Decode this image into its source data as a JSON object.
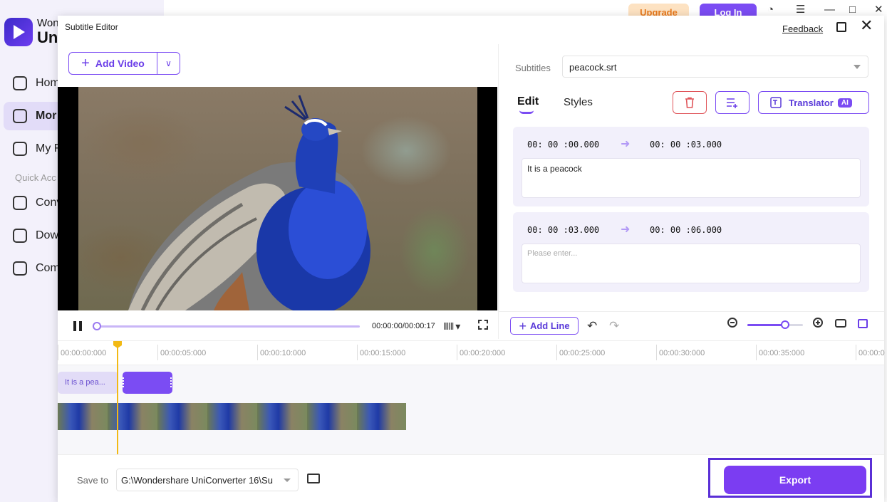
{
  "background_app": {
    "brand_line1": "Won",
    "brand_line2": "Un",
    "nav": [
      "Hom",
      "Mor",
      "My F",
      "Conv",
      "Dow",
      "Com"
    ],
    "quick_access": "Quick Acc",
    "upgrade": "Upgrade",
    "login": "Log In"
  },
  "dialog": {
    "title": "Subtitle Editor",
    "feedback": "Feedback"
  },
  "left": {
    "add_video": "Add Video",
    "timecode": "00:00:00/00:00:17"
  },
  "right": {
    "subtitles_label": "Subtitles",
    "subtitles_file": "peacock.srt",
    "tabs": {
      "edit": "Edit",
      "styles": "Styles"
    },
    "translator": "Translator",
    "ai_badge": "AI",
    "entries": [
      {
        "start": "00: 00 :00.000",
        "end": "00: 00 :03.000",
        "text": "It is a peacock"
      },
      {
        "start": "00: 00 :03.000",
        "end": "00: 00 :06.000",
        "placeholder": "Please enter..."
      }
    ],
    "add_line": "Add Line",
    "zoom_level": 0.68
  },
  "timeline": {
    "ticks": [
      "00:00:00:000",
      "00:00:05:000",
      "00:00:10:000",
      "00:00:15:000",
      "00:00:20:000",
      "00:00:25:000",
      "00:00:30:000",
      "00:00:35:000",
      "00:00:0"
    ],
    "clip_label": "It is a pea..."
  },
  "footer": {
    "save_to_label": "Save to",
    "save_path": "G:\\Wondershare UniConverter 16\\Su",
    "export": "Export"
  },
  "colors": {
    "accent": "#7b4cf3",
    "delete": "#e0565b",
    "playhead": "#f2b914"
  }
}
